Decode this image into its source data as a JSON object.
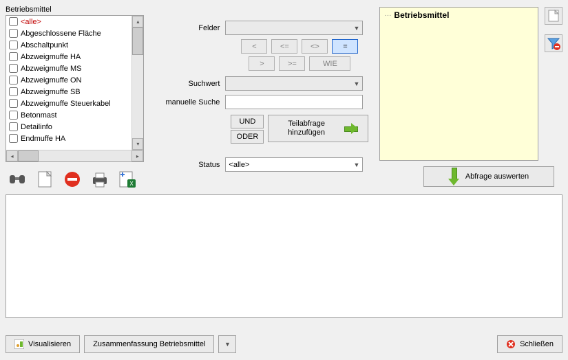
{
  "left": {
    "title": "Betriebsmittel",
    "items": [
      {
        "label": "<alle>",
        "red": true
      },
      {
        "label": "Abgeschlossene Fläche"
      },
      {
        "label": "Abschaltpunkt"
      },
      {
        "label": "Abzweigmuffe HA"
      },
      {
        "label": "Abzweigmuffe MS"
      },
      {
        "label": "Abzweigmuffe ON"
      },
      {
        "label": "Abzweigmuffe SB"
      },
      {
        "label": "Abzweigmuffe Steuerkabel"
      },
      {
        "label": "Betonmast"
      },
      {
        "label": "Detailinfo"
      },
      {
        "label": "Endmuffe HA"
      }
    ]
  },
  "form": {
    "felder_label": "Felder",
    "suchwert_label": "Suchwert",
    "manuelle_label": "manuelle Suche",
    "status_label": "Status",
    "status_value": "<alle>"
  },
  "ops": {
    "lt": "<",
    "lte": "<=",
    "ne": "<>",
    "eq": "=",
    "gt": ">",
    "gte": ">=",
    "like": "WIE",
    "and": "UND",
    "or": "ODER",
    "add_sub": "Teilabfrage hinzufügen"
  },
  "tree": {
    "root": "Betriebsmittel"
  },
  "actions": {
    "evaluate": "Abfrage auswerten",
    "visualize": "Visualisieren",
    "summary": "Zusammenfassung Betriebsmittel",
    "close": "Schließen"
  }
}
